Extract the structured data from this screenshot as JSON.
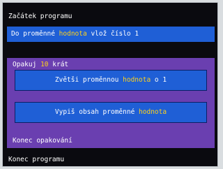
{
  "program": {
    "start": "Začátek programu",
    "assign": {
      "prefix": "Do proměnné",
      "variable": "hodnota",
      "suffix": "vlož číslo 1"
    },
    "loop": {
      "prefix": "Opakuj",
      "count": "10",
      "suffix": "krát",
      "body": [
        {
          "prefix": "Zvětši proměnnou",
          "variable": "hodnota",
          "suffix": "o 1"
        },
        {
          "prefix": "Vypiš obsah proměnné",
          "variable": "hodnota",
          "suffix": ""
        }
      ],
      "end": "Konec opakování"
    },
    "end": "Konec programu"
  },
  "colors": {
    "background": "#0a0a0f",
    "block": "#1f5fd6",
    "loop": "#6a3fb0",
    "highlight": "#ffd21a"
  }
}
